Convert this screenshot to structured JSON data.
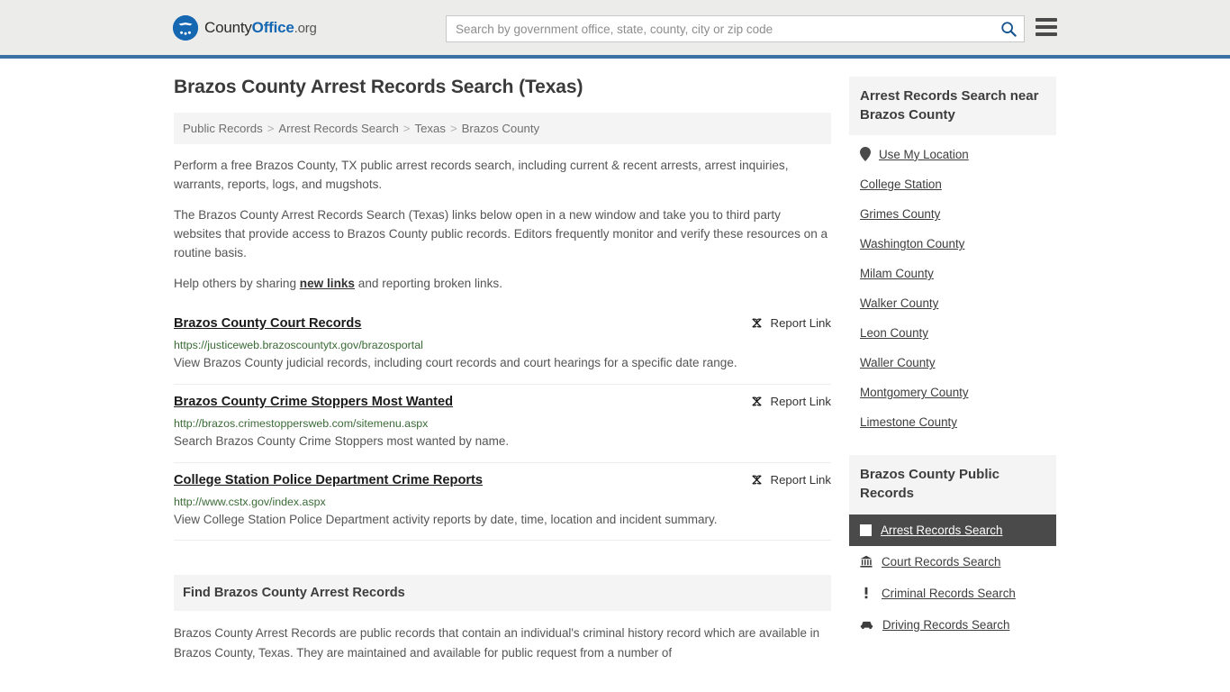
{
  "header": {
    "logo_name": "CountyOffice.org",
    "logo_parts": {
      "first": "County",
      "bold": "Office",
      "suffix": ".org"
    },
    "search_placeholder": "Search by government office, state, county, city or zip code",
    "search_value": "",
    "search_icon": "search-icon",
    "menu_icon": "hamburger-menu-icon",
    "accent_color": "#3b72a3",
    "logo_blue": "#1567b2"
  },
  "page": {
    "title": "Brazos County Arrest Records Search (Texas)"
  },
  "breadcrumb": {
    "separator": ">",
    "items": [
      {
        "label": "Public Records"
      },
      {
        "label": "Arrest Records Search"
      },
      {
        "label": "Texas"
      },
      {
        "label": "Brazos County"
      }
    ]
  },
  "intro": {
    "paragraph1": "Perform a free Brazos County, TX public arrest records search, including current & recent arrests, arrest inquiries, warrants, reports, logs, and mugshots.",
    "paragraph2": "The Brazos County Arrest Records Search (Texas) links below open in a new window and take you to third party websites that provide access to Brazos County public records. Editors frequently monitor and verify these resources on a routine basis.",
    "paragraph3_before": "Help others by sharing ",
    "paragraph3_link": "new links",
    "paragraph3_after": " and reporting broken links."
  },
  "results": {
    "report_label": "Report Link",
    "report_icon": "broken-link-icon",
    "items": [
      {
        "title": "Brazos County Court Records",
        "url": "https://justiceweb.brazoscountytx.gov/brazosportal",
        "description": "View Brazos County judicial records, including court records and court hearings for a specific date range."
      },
      {
        "title": "Brazos County Crime Stoppers Most Wanted",
        "url": "http://brazos.crimestoppersweb.com/sitemenu.aspx",
        "description": "Search Brazos County Crime Stoppers most wanted by name."
      },
      {
        "title": "College Station Police Department Crime Reports",
        "url": "http://www.cstx.gov/index.aspx",
        "description": "View College Station Police Department activity reports by date, time, location and incident summary."
      }
    ]
  },
  "find_section": {
    "heading": "Find Brazos County Arrest Records",
    "body": "Brazos County Arrest Records are public records that contain an individual's criminal history record which are available in Brazos County, Texas. They are maintained and available for public request from a number of"
  },
  "sidebar": {
    "nearby": {
      "heading": "Arrest Records Search near Brazos County",
      "location_icon": "map-pin-icon",
      "items": [
        {
          "label": "Use My Location",
          "icon": "map-pin-icon"
        },
        {
          "label": "College Station",
          "icon": ""
        },
        {
          "label": "Grimes County",
          "icon": ""
        },
        {
          "label": "Washington County",
          "icon": ""
        },
        {
          "label": "Milam County",
          "icon": ""
        },
        {
          "label": "Walker County",
          "icon": ""
        },
        {
          "label": "Leon County",
          "icon": ""
        },
        {
          "label": "Waller County",
          "icon": ""
        },
        {
          "label": "Montgomery County",
          "icon": ""
        },
        {
          "label": "Limestone County",
          "icon": ""
        }
      ]
    },
    "public_records": {
      "heading": "Brazos County Public Records",
      "items": [
        {
          "label": "Arrest Records Search",
          "icon": "fingerprint-square-icon",
          "active": true
        },
        {
          "label": "Court Records Search",
          "icon": "courthouse-icon",
          "active": false
        },
        {
          "label": "Criminal Records Search",
          "icon": "exclamation-icon",
          "active": false
        },
        {
          "label": "Driving Records Search",
          "icon": "car-icon",
          "active": false
        }
      ]
    }
  }
}
